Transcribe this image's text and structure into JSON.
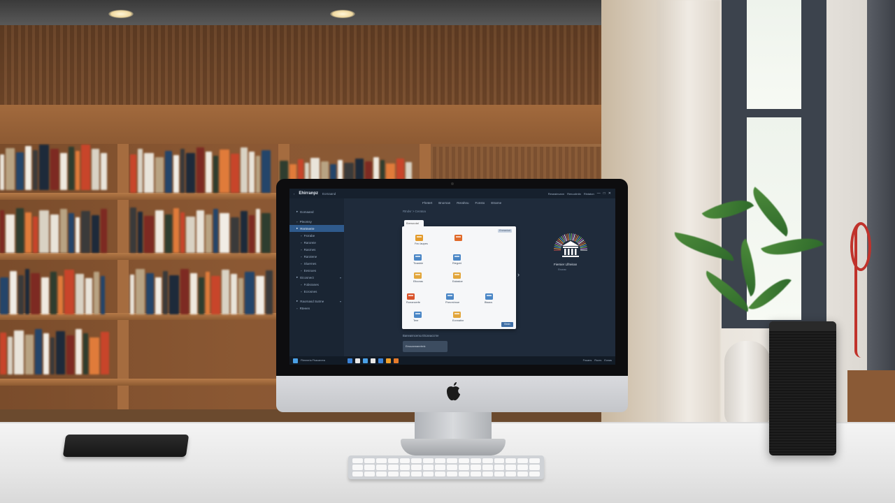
{
  "app": {
    "brand": "Ehirranpz",
    "tabs": [
      "Eomaand"
    ],
    "toolbar_right": [
      "Reseainvann",
      "Renuciintin",
      "Rintaton"
    ],
    "window_controls": [
      "—",
      "□",
      "✕"
    ]
  },
  "sidebar": {
    "items": [
      {
        "label": "Eomaand",
        "icon": "folder-icon",
        "active": false
      },
      {
        "label": "Pleomsy",
        "icon": "file-icon",
        "active": false
      },
      {
        "label": "Rnrtmerre",
        "icon": "folder-icon",
        "active": true
      },
      {
        "label": "Fsrrabe",
        "icon": "file-icon",
        "active": false
      },
      {
        "label": "Raroreie",
        "icon": "file-icon",
        "active": false
      },
      {
        "label": "Rasrnes",
        "icon": "file-icon",
        "active": false
      },
      {
        "label": "Rarotene",
        "icon": "file-icon",
        "active": false
      },
      {
        "label": "Sluernes",
        "icon": "file-icon",
        "active": false
      },
      {
        "label": "Eesnoes",
        "icon": "file-icon",
        "active": false
      },
      {
        "label": "Eicosnect",
        "icon": "folder-icon",
        "active": false
      },
      {
        "label": "Fobsranes",
        "icon": "file-icon",
        "active": false
      },
      {
        "label": "Ecrosnes",
        "icon": "file-icon",
        "active": false
      },
      {
        "label": "Raornasd Sutrne",
        "icon": "folder-icon",
        "active": false
      },
      {
        "label": "Rteeen",
        "icon": "file-icon",
        "active": false
      }
    ]
  },
  "topnav": [
    "Fhetert",
    "Bnornan",
    "Rerahnu",
    "Fonsto",
    "Etrarne"
  ],
  "breadcrumb": "Rtndvr > Ceratoa",
  "dialog": {
    "tab": "Brewoutal",
    "badge": "Enrraniud",
    "items": [
      {
        "label": "Feo laupes",
        "icon": "edit-icon",
        "color": "#e39b2c"
      },
      {
        "label": "",
        "icon": "book-icon",
        "color": "#e06a2a"
      },
      {
        "label": "Tlcasbie",
        "icon": "printer-icon",
        "color": "#4a86c6"
      },
      {
        "label": "Riegvet",
        "icon": "monitor-icon",
        "color": "#4a86c6"
      },
      {
        "label": "Eltooras",
        "icon": "folder-icon",
        "color": "#e2a63b"
      },
      {
        "label": "Ealastoe",
        "icon": "key-icon",
        "color": "#e2a63b"
      },
      {
        "label": "Rorrancerfe",
        "icon": "chrome-icon",
        "color": "#d9532b"
      },
      {
        "label": "Fhecrshnue",
        "icon": "window-icon",
        "color": "#4a86c6"
      },
      {
        "label": "Bisacs",
        "icon": "globe-icon",
        "color": "#4a86c6"
      },
      {
        "label": "Tere",
        "icon": "stack-icon",
        "color": "#4a86c6"
      },
      {
        "label": "Eonnatinr",
        "icon": "house-icon",
        "color": "#e2a63b"
      }
    ],
    "ok": "Bmin"
  },
  "status_line": "Baneanncerxu  Etcanaccrne",
  "field_value": "Eeuuannanrtrnk",
  "logo": {
    "caption": "Fiemier Llfreiran",
    "sub": "Eisanac"
  },
  "taskbar": {
    "start": "Fliemeria Fhacanrea",
    "icons": [
      "#3b82d6",
      "#e7e7e7",
      "#4aa0e6",
      "#e7e7e7",
      "#3b82d6",
      "#f0a02a",
      "#e57a2b"
    ],
    "tray": [
      "Fnuans",
      "Rucrs",
      "Eonas"
    ]
  },
  "colors": {
    "accent": "#2f5a8c",
    "screen_bg": "#1f2b3b"
  }
}
